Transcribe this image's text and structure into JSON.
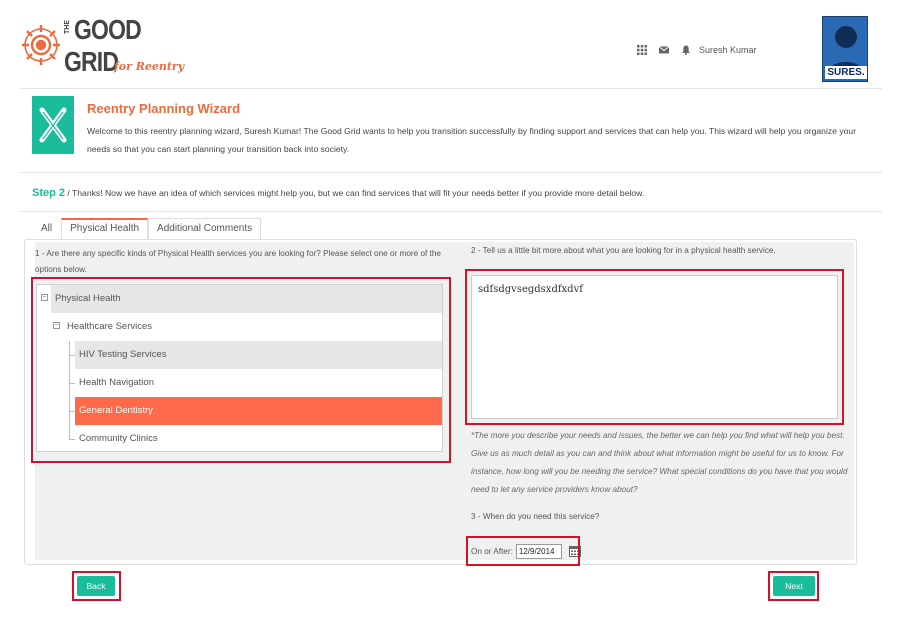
{
  "header": {
    "logo": {
      "the": "THE",
      "good": "GOOD",
      "grid": "GRID",
      "reentry": "for Reentry"
    },
    "icons": [
      "apps-grid-icon",
      "envelope-icon",
      "bell-icon"
    ],
    "user_name": "Suresh Kumar",
    "avatar_label": "SURES."
  },
  "intro": {
    "title": "Reentry Planning Wizard",
    "text": "Welcome to this reentry planning wizard, Suresh Kumar! The Good Grid wants to help you transition successfully by finding support and services that can help you. This wizard will help you organize your needs so that you can start planning your transition back into society."
  },
  "step": {
    "label": "Step 2",
    "text": " / Thanks! Now we have an idea of which services might help you, but we can find services that will fit your needs better if you provide more detail below."
  },
  "tabs": [
    {
      "label": "All"
    },
    {
      "label": "Physical Health"
    },
    {
      "label": "Additional Comments"
    }
  ],
  "form": {
    "q1": "1 - Are there any specific kinds of Physical Health services you are looking for? Please select one or more of the options below.",
    "tree": [
      {
        "label": "Physical Health",
        "toggle": "−"
      },
      {
        "label": "Healthcare Services",
        "toggle": "−"
      },
      {
        "label": "HIV Testing Services"
      },
      {
        "label": "Health Navigation"
      },
      {
        "label": "General Dentistry",
        "selected": true
      },
      {
        "label": "Community Clinics"
      }
    ],
    "q2": "2 - Tell us a little bit more about what you are looking for in a physical health service.",
    "textarea_value": "sdfsdgvsegdsxdfxdvf",
    "help_text": "*The more you describe your needs and issues, the better we can help you find what will help you best. Give us as much detail as you can and think about what information might be useful for us to know. For instance, how long will you be needing the service? What special conditions do you have that you would need to let any service providers know about?",
    "q3": "3 - When do you need this service?",
    "date_label": "On or After:",
    "date_value": "12/9/2014"
  },
  "buttons": {
    "back": "Back",
    "next": "Next"
  },
  "colors": {
    "accent_teal": "#1bbc9b",
    "accent_orange": "#ed6a3e",
    "selected_row": "#ff6b4a",
    "highlight_red": "#d3122a"
  }
}
